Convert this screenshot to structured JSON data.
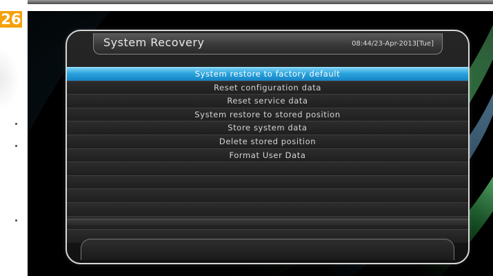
{
  "page_badge": "26",
  "header": {
    "title": "System Recovery",
    "datetime": "08:44/23-Apr-2013[Tue]"
  },
  "menu": {
    "selected_index": 0,
    "items": [
      "System restore to factory default",
      "Reset configuration data",
      "Reset service data",
      "System restore to stored position",
      "Store system data",
      "Delete stored position",
      "Format User Data"
    ],
    "empty_rows": 7
  },
  "colors": {
    "selection": "#2aa4dd",
    "badge": "#f5a10b",
    "accent_green": "#27e04a"
  }
}
